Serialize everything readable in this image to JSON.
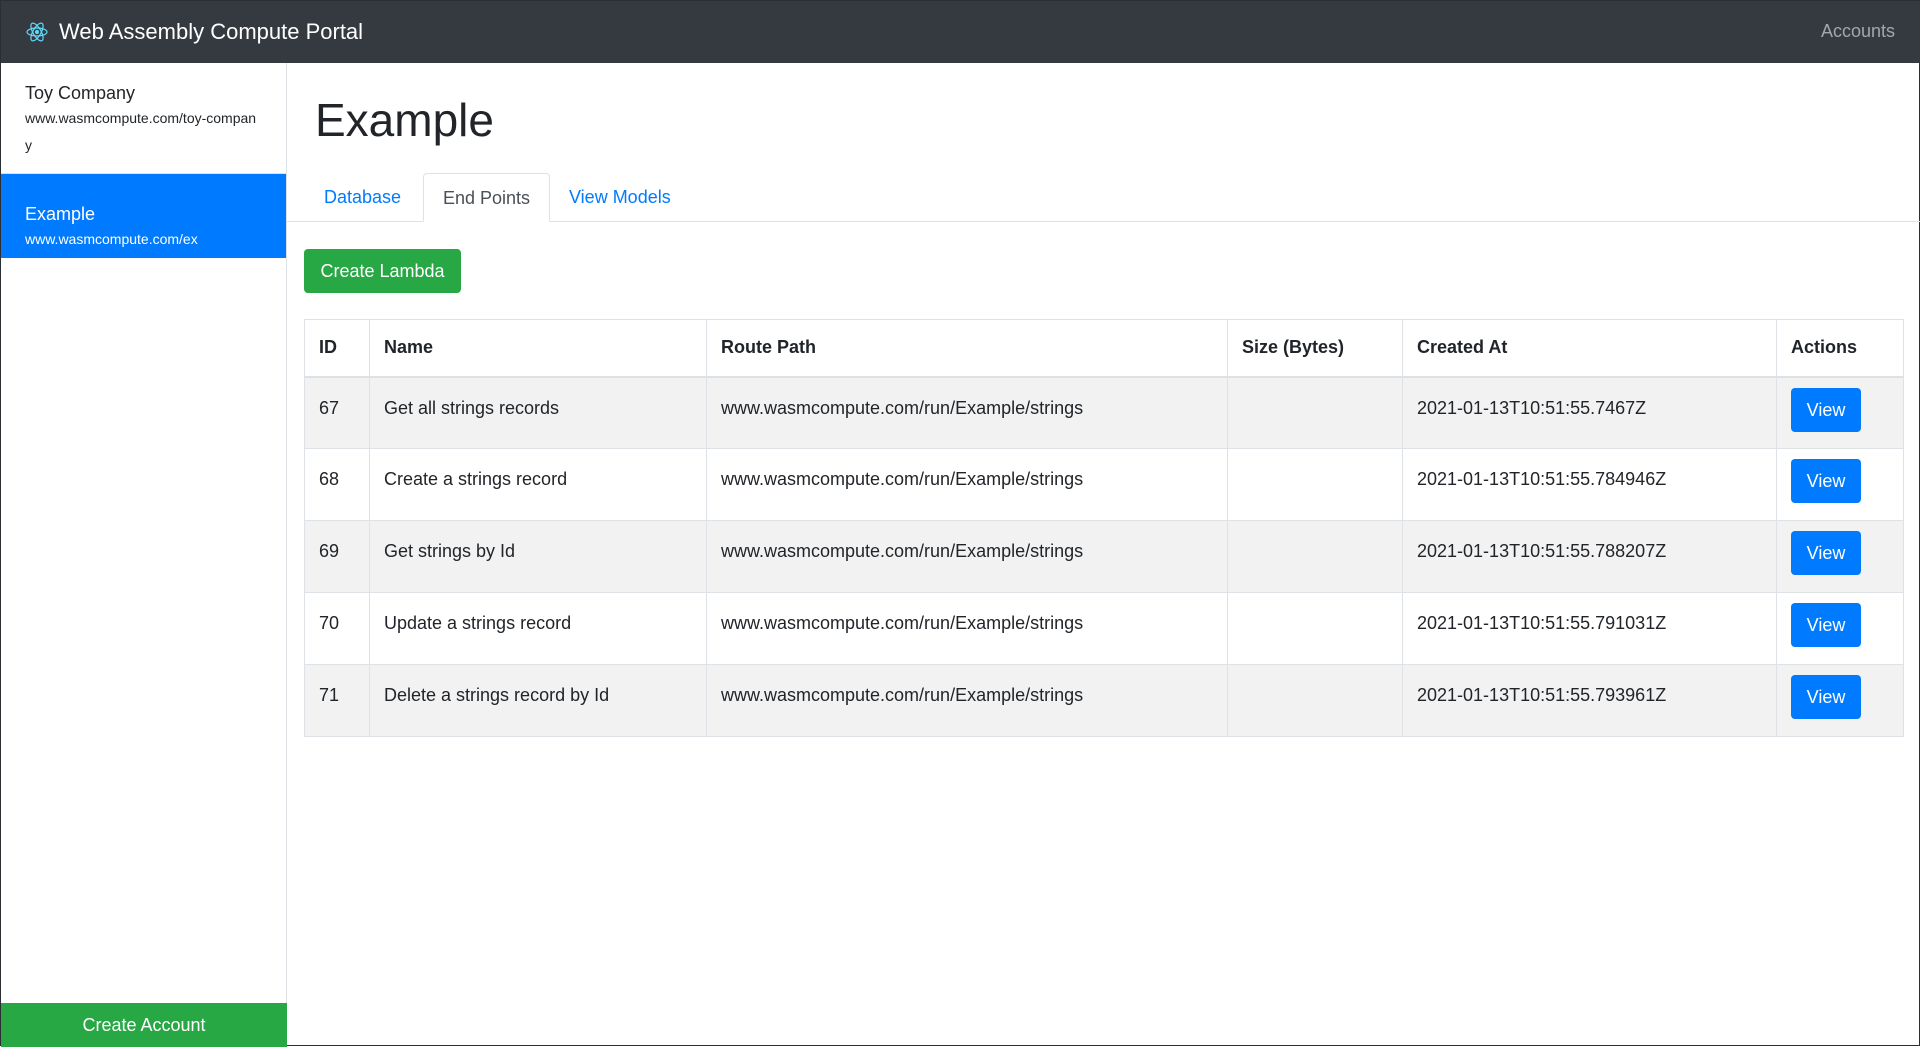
{
  "navbar": {
    "brand": "Web Assembly Compute Portal",
    "brand_icon": "react-atom-icon",
    "right_link": "Accounts"
  },
  "sidebar": {
    "items": [
      {
        "title": "Toy Company",
        "subtitle": "www.wasmcompute.com/toy-company",
        "active": false
      },
      {
        "title": "Example",
        "subtitle": "www.wasmcompute.com/ex",
        "active": true
      }
    ],
    "create_button": "Create Account"
  },
  "main": {
    "title": "Example",
    "tabs": [
      {
        "label": "Database",
        "active": false
      },
      {
        "label": "End Points",
        "active": true
      },
      {
        "label": "View Models",
        "active": false
      }
    ],
    "create_button": "Create Lambda",
    "table": {
      "headers": [
        "ID",
        "Name",
        "Route Path",
        "Size (Bytes)",
        "Created At",
        "Actions"
      ],
      "rows": [
        {
          "id": "67",
          "name": "Get all strings records",
          "route": "www.wasmcompute.com/run/Example/strings",
          "size": "",
          "created": "2021-01-13T10:51:55.7467Z",
          "action": "View"
        },
        {
          "id": "68",
          "name": "Create a strings record",
          "route": "www.wasmcompute.com/run/Example/strings",
          "size": "",
          "created": "2021-01-13T10:51:55.784946Z",
          "action": "View"
        },
        {
          "id": "69",
          "name": "Get strings by Id",
          "route": "www.wasmcompute.com/run/Example/strings",
          "size": "",
          "created": "2021-01-13T10:51:55.788207Z",
          "action": "View"
        },
        {
          "id": "70",
          "name": "Update a strings record",
          "route": "www.wasmcompute.com/run/Example/strings",
          "size": "",
          "created": "2021-01-13T10:51:55.791031Z",
          "action": "View"
        },
        {
          "id": "71",
          "name": "Delete a strings record by Id",
          "route": "www.wasmcompute.com/run/Example/strings",
          "size": "",
          "created": "2021-01-13T10:51:55.793961Z",
          "action": "View"
        }
      ]
    }
  },
  "colors": {
    "navbar": "#343a40",
    "primary": "#007bff",
    "success": "#28a745"
  }
}
